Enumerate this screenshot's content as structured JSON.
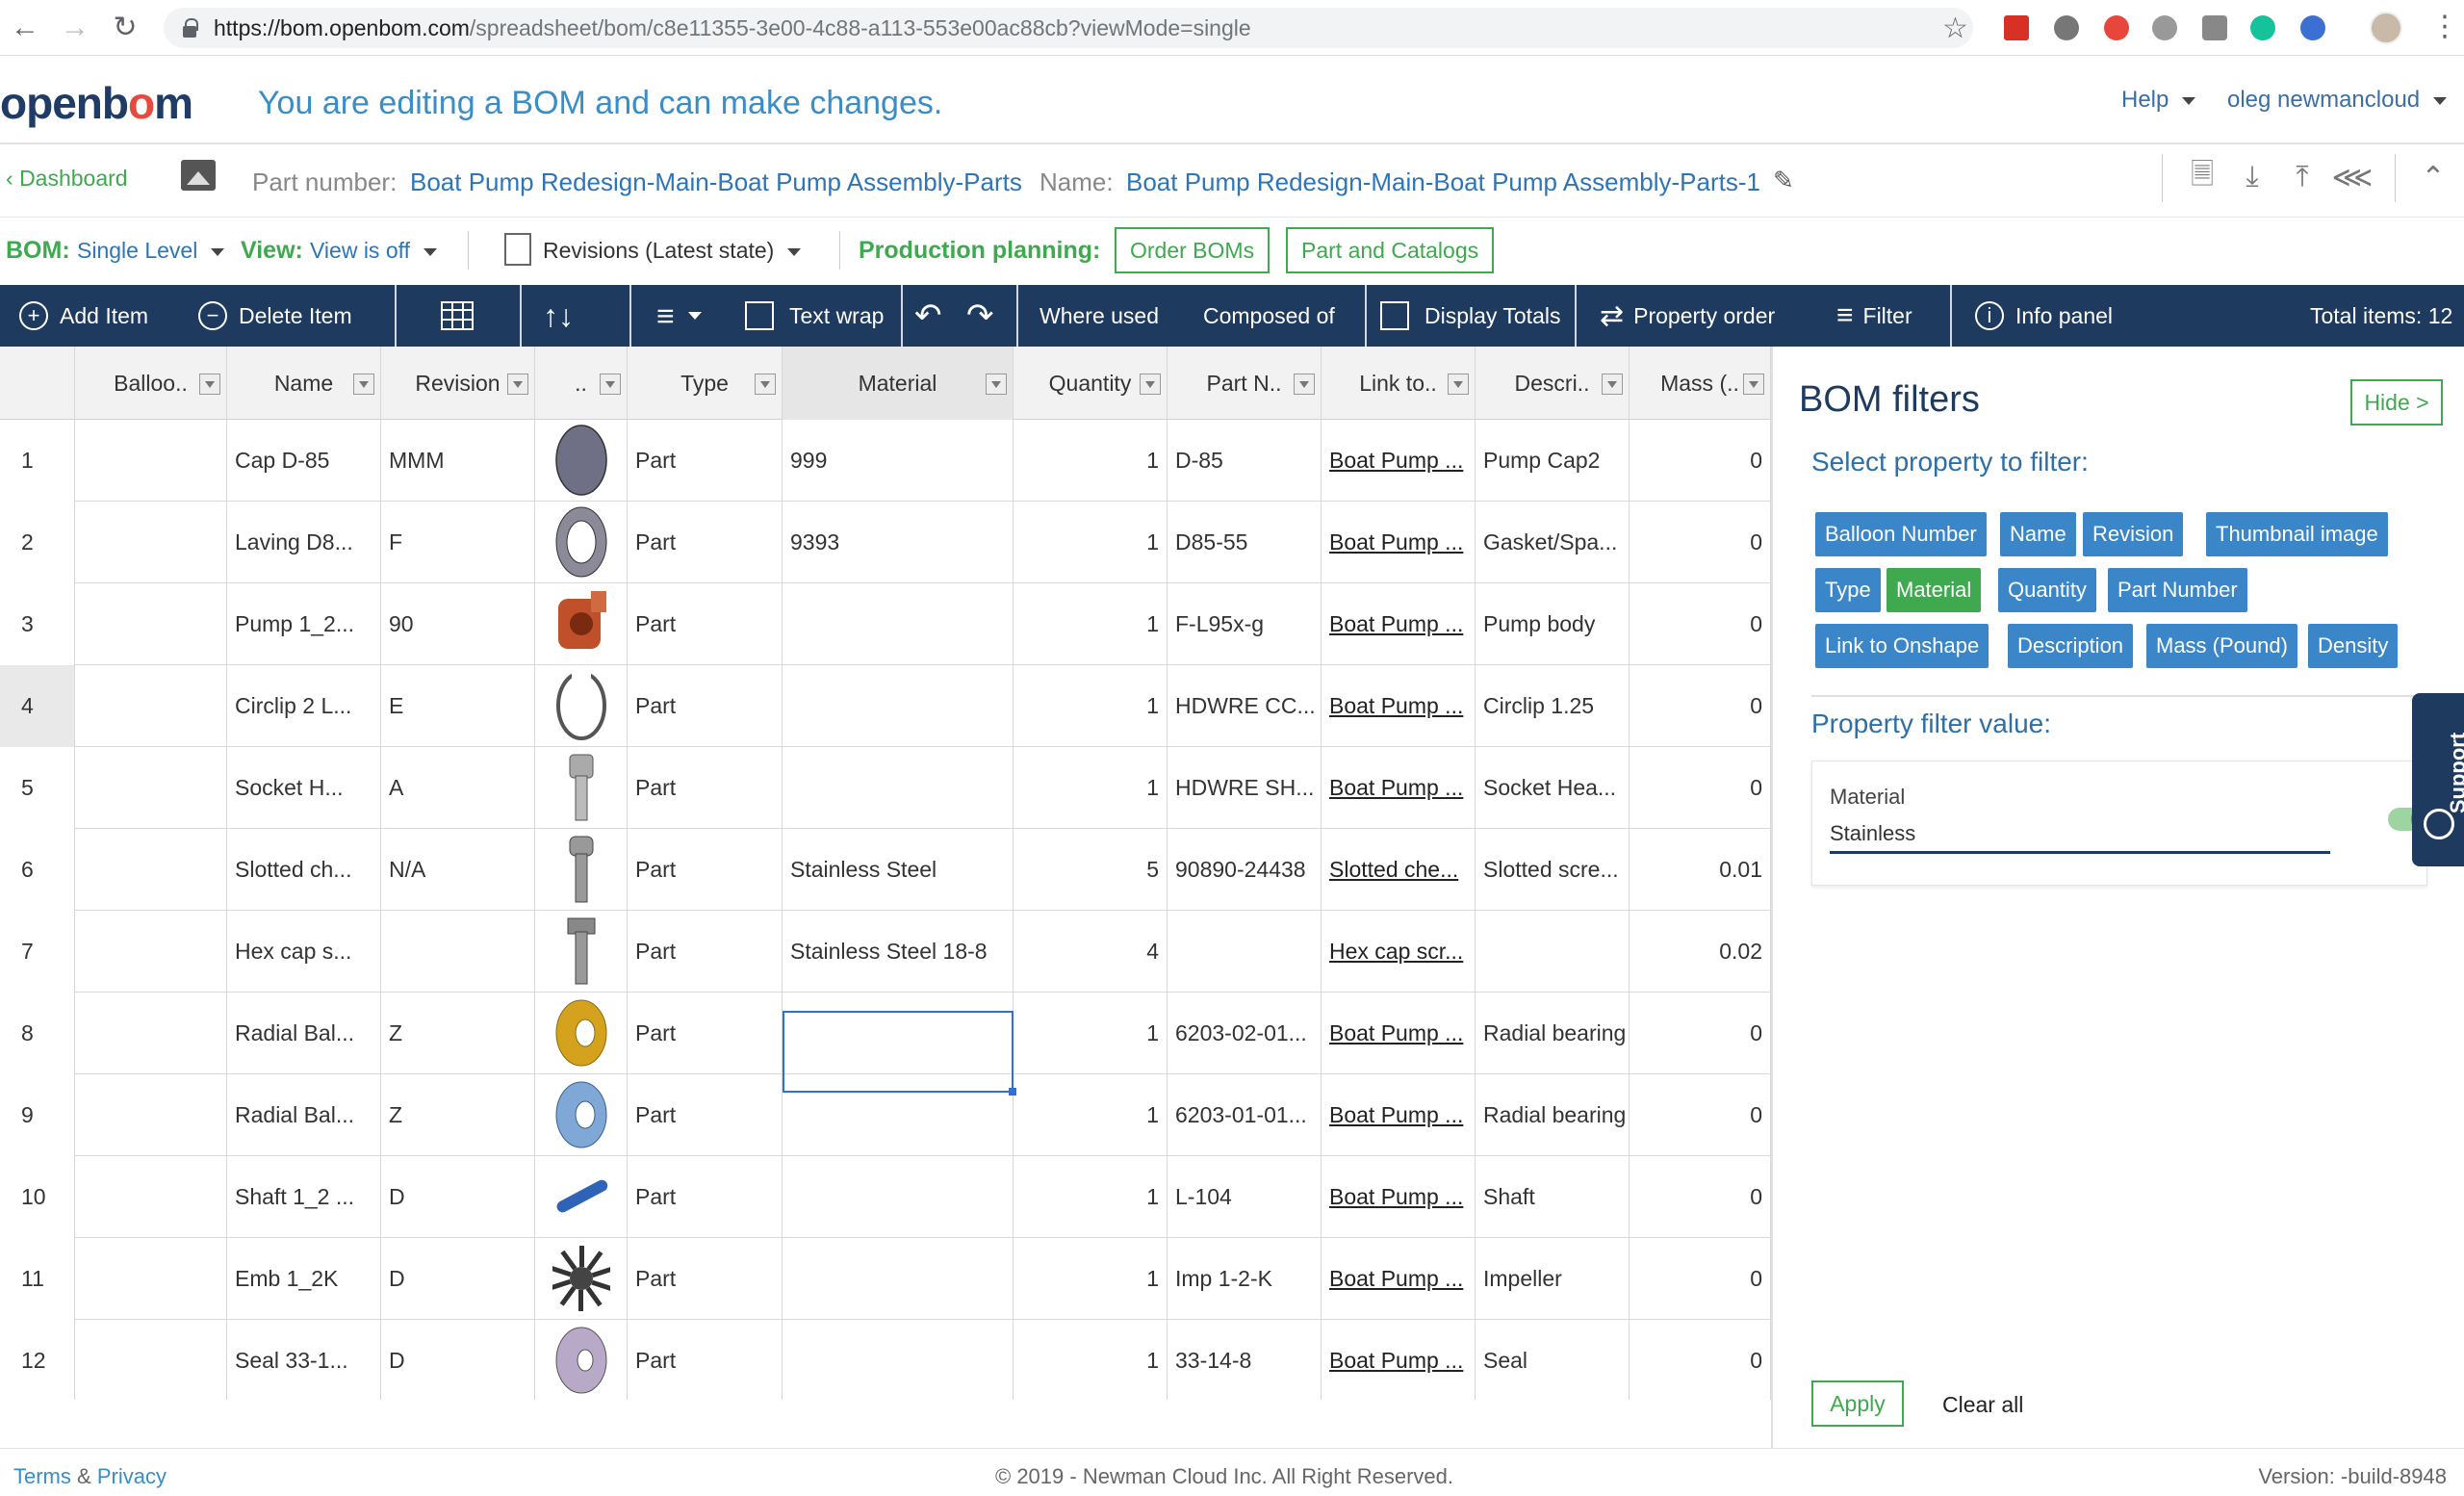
{
  "browser": {
    "url_host": "https://bom.openbom.com",
    "url_path": "/spreadsheet/bom/c8e11355-3e00-4c88-a113-553e00ac88cb?viewMode=single"
  },
  "header": {
    "logo": "openbom",
    "edit_message": "You are editing a BOM and can make changes.",
    "help": "Help",
    "user": "oleg newmancloud"
  },
  "partbar": {
    "dashboard": "Dashboard",
    "part_number_label": "Part number:",
    "part_number": "Boat Pump Redesign-Main-Boat Pump Assembly-Parts",
    "name_label": "Name:",
    "name": "Boat Pump Redesign-Main-Boat Pump Assembly-Parts-1"
  },
  "bombar": {
    "bom_label": "BOM:",
    "bom_value": "Single Level",
    "view_label": "View:",
    "view_value": "View is off",
    "revisions": "Revisions (Latest state)",
    "production_label": "Production planning:",
    "order_boms": "Order BOMs",
    "part_catalogs": "Part and Catalogs"
  },
  "toolbar": {
    "add_item": "Add Item",
    "delete_item": "Delete Item",
    "text_wrap": "Text wrap",
    "where_used": "Where used",
    "composed_of": "Composed of",
    "display_totals": "Display Totals",
    "property_order": "Property order",
    "filter": "Filter",
    "info_panel": "Info panel",
    "total_items": "Total items: 12"
  },
  "grid": {
    "columns": [
      "Balloo..",
      "Name",
      "Revision",
      "..",
      "Type",
      "Material",
      "Quantity",
      "Part N..",
      "Link to..",
      "Descri..",
      "Mass (.."
    ],
    "rows": [
      {
        "n": "1",
        "name": "Cap D-85",
        "rev": "MMM",
        "type": "Part",
        "material": "999",
        "qty": "1",
        "pn": "D-85",
        "link": "Boat Pump ...",
        "desc": "Pump Cap2",
        "mass": "0",
        "thumb": "cap"
      },
      {
        "n": "2",
        "name": "Laving D8...",
        "rev": "F",
        "type": "Part",
        "material": "9393",
        "qty": "1",
        "pn": "D85-55",
        "link": "Boat Pump ...",
        "desc": "Gasket/Spa...",
        "mass": "0",
        "thumb": "gasket"
      },
      {
        "n": "3",
        "name": "Pump 1_2...",
        "rev": "90",
        "type": "Part",
        "material": "",
        "qty": "1",
        "pn": "F-L95x-g",
        "link": "Boat Pump ...",
        "desc": "Pump body",
        "mass": "0",
        "thumb": "body"
      },
      {
        "n": "4",
        "name": "Circlip 2 L...",
        "rev": "E",
        "type": "Part",
        "material": "",
        "qty": "1",
        "pn": "HDWRE CC...",
        "link": "Boat Pump ...",
        "desc": "Circlip 1.25",
        "mass": "0",
        "thumb": "circlip"
      },
      {
        "n": "5",
        "name": "Socket H...",
        "rev": "A",
        "type": "Part",
        "material": "",
        "qty": "1",
        "pn": "HDWRE SH...",
        "link": "Boat Pump ...",
        "desc": "Socket Hea...",
        "mass": "0",
        "thumb": "socket"
      },
      {
        "n": "6",
        "name": "Slotted ch...",
        "rev": "N/A",
        "type": "Part",
        "material": "Stainless Steel",
        "qty": "5",
        "pn": "90890-24438",
        "link": "Slotted che...",
        "desc": "Slotted scre...",
        "mass": "0.01",
        "thumb": "slotted"
      },
      {
        "n": "7",
        "name": "Hex cap s...",
        "rev": "",
        "type": "Part",
        "material": "Stainless Steel 18-8",
        "qty": "4",
        "pn": "",
        "link": "Hex cap scr...",
        "desc": "",
        "mass": "0.02",
        "thumb": "hex"
      },
      {
        "n": "8",
        "name": "Radial Bal...",
        "rev": "Z",
        "type": "Part",
        "material": "",
        "qty": "1",
        "pn": "6203-02-01...",
        "link": "Boat Pump ...",
        "desc": "Radial bearing",
        "mass": "0",
        "thumb": "bearing-gold"
      },
      {
        "n": "9",
        "name": "Radial Bal...",
        "rev": "Z",
        "type": "Part",
        "material": "",
        "qty": "1",
        "pn": "6203-01-01...",
        "link": "Boat Pump ...",
        "desc": "Radial bearing",
        "mass": "0",
        "thumb": "bearing-blue"
      },
      {
        "n": "10",
        "name": "Shaft 1_2 ...",
        "rev": "D",
        "type": "Part",
        "material": "",
        "qty": "1",
        "pn": "L-104",
        "link": "Boat Pump ...",
        "desc": "Shaft",
        "mass": "0",
        "thumb": "shaft"
      },
      {
        "n": "11",
        "name": "Emb 1_2K",
        "rev": "D",
        "type": "Part",
        "material": "",
        "qty": "1",
        "pn": "Imp 1-2-K",
        "link": "Boat Pump ...",
        "desc": "Impeller",
        "mass": "0",
        "thumb": "impeller"
      },
      {
        "n": "12",
        "name": "Seal 33-1...",
        "rev": "D",
        "type": "Part",
        "material": "",
        "qty": "1",
        "pn": "33-14-8",
        "link": "Boat Pump ...",
        "desc": "Seal",
        "mass": "0",
        "thumb": "seal"
      }
    ]
  },
  "panel": {
    "title": "BOM filters",
    "hide": "Hide >",
    "select_label": "Select property to filter:",
    "properties": [
      "Balloon Number",
      "Name",
      "Revision",
      "Thumbnail image",
      "Type",
      "Material",
      "Quantity",
      "Part Number",
      "Link to Onshape",
      "Description",
      "Mass (Pound)",
      "Density"
    ],
    "active_property": "Material",
    "value_label": "Property filter value:",
    "filter_field_label": "Material",
    "filter_value": "Stainless",
    "apply": "Apply",
    "clear_all": "Clear all",
    "support": "Support"
  },
  "footer": {
    "terms": "Terms",
    "amp": "&",
    "privacy": "Privacy",
    "copyright": "© 2019 - Newman Cloud Inc. All Right Reserved.",
    "version": "Version: -build-8948"
  }
}
